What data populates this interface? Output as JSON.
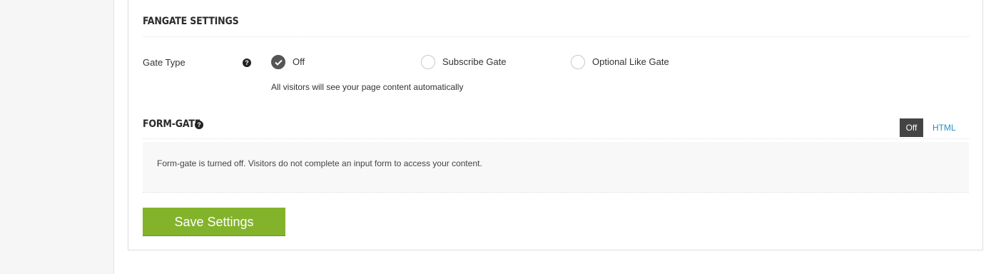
{
  "fangate": {
    "section_title": "FANGATE SETTINGS",
    "gate_type_label": "Gate Type",
    "help_glyph": "?",
    "options": [
      {
        "label": "Off",
        "checked": true
      },
      {
        "label": "Subscribe Gate",
        "checked": false
      },
      {
        "label": "Optional Like Gate",
        "checked": false
      }
    ],
    "hint": "All visitors will see your page content automatically"
  },
  "formgate": {
    "section_title": "FORM-GATE",
    "help_glyph": "?",
    "toggle": {
      "off_label": "Off",
      "html_label": "HTML",
      "selected": "Off"
    },
    "info_text": "Form-gate is turned off. Visitors do not complete an input form to access your content."
  },
  "actions": {
    "save_label": "Save Settings"
  },
  "colors": {
    "accent_green": "#83b32b",
    "link_blue": "#2a8fbd",
    "toggle_dark": "#444444"
  }
}
